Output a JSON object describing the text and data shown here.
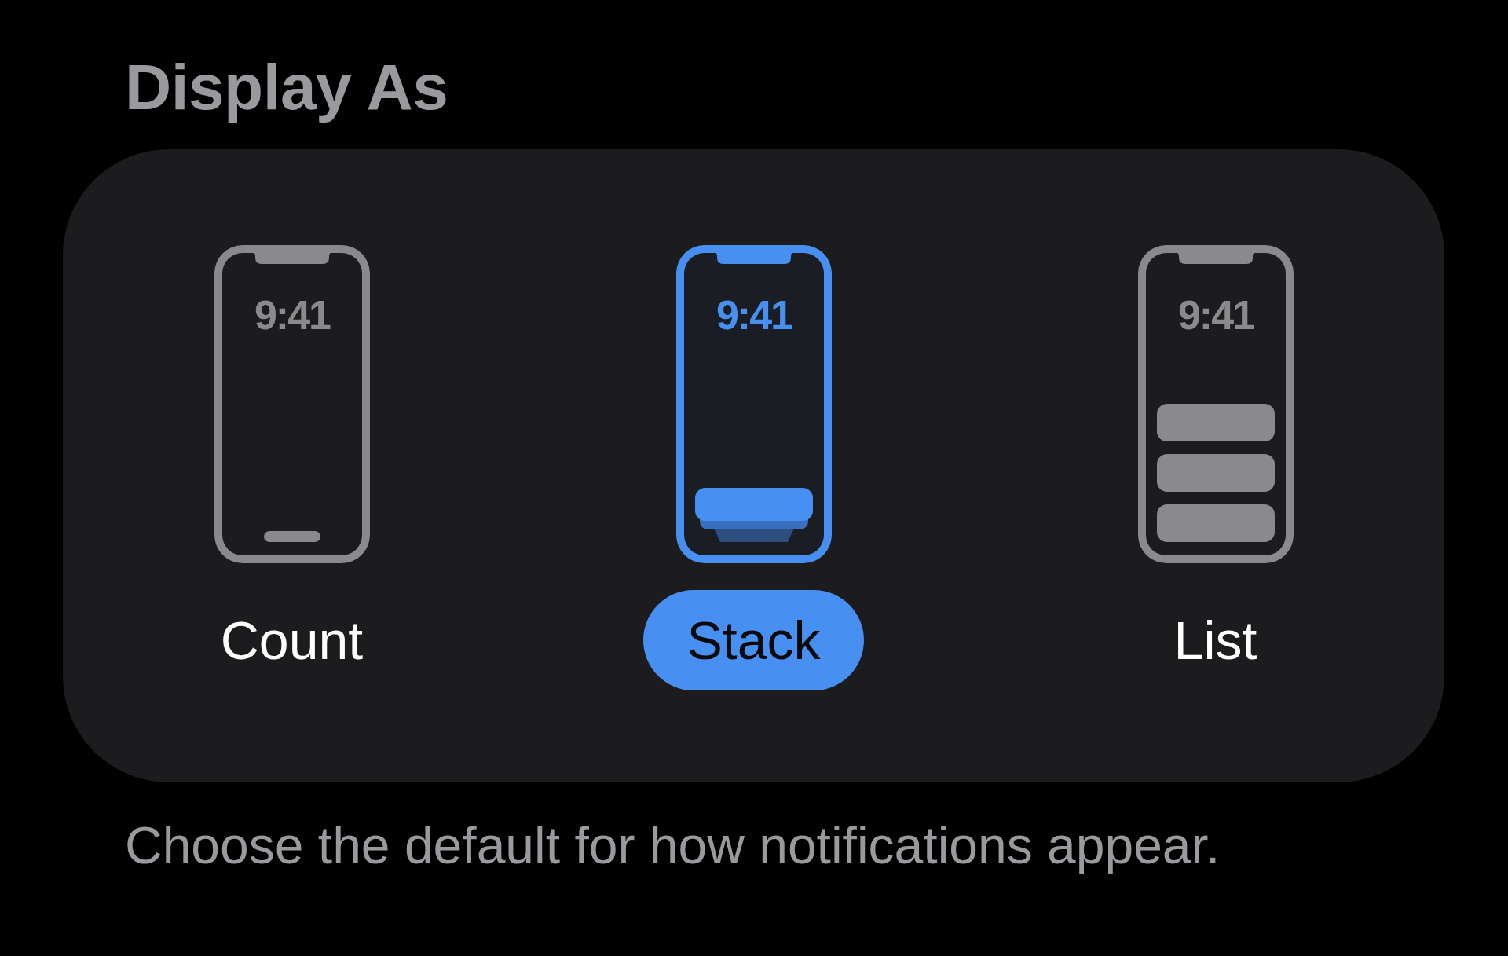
{
  "section": {
    "title": "Display As",
    "footer": "Choose the default for how notifications appear."
  },
  "options": [
    {
      "kind": "count",
      "time": "9:41",
      "label": "Count",
      "selected": false
    },
    {
      "kind": "stack",
      "time": "9:41",
      "label": "Stack",
      "selected": true
    },
    {
      "kind": "list",
      "time": "9:41",
      "label": "List",
      "selected": false
    }
  ]
}
